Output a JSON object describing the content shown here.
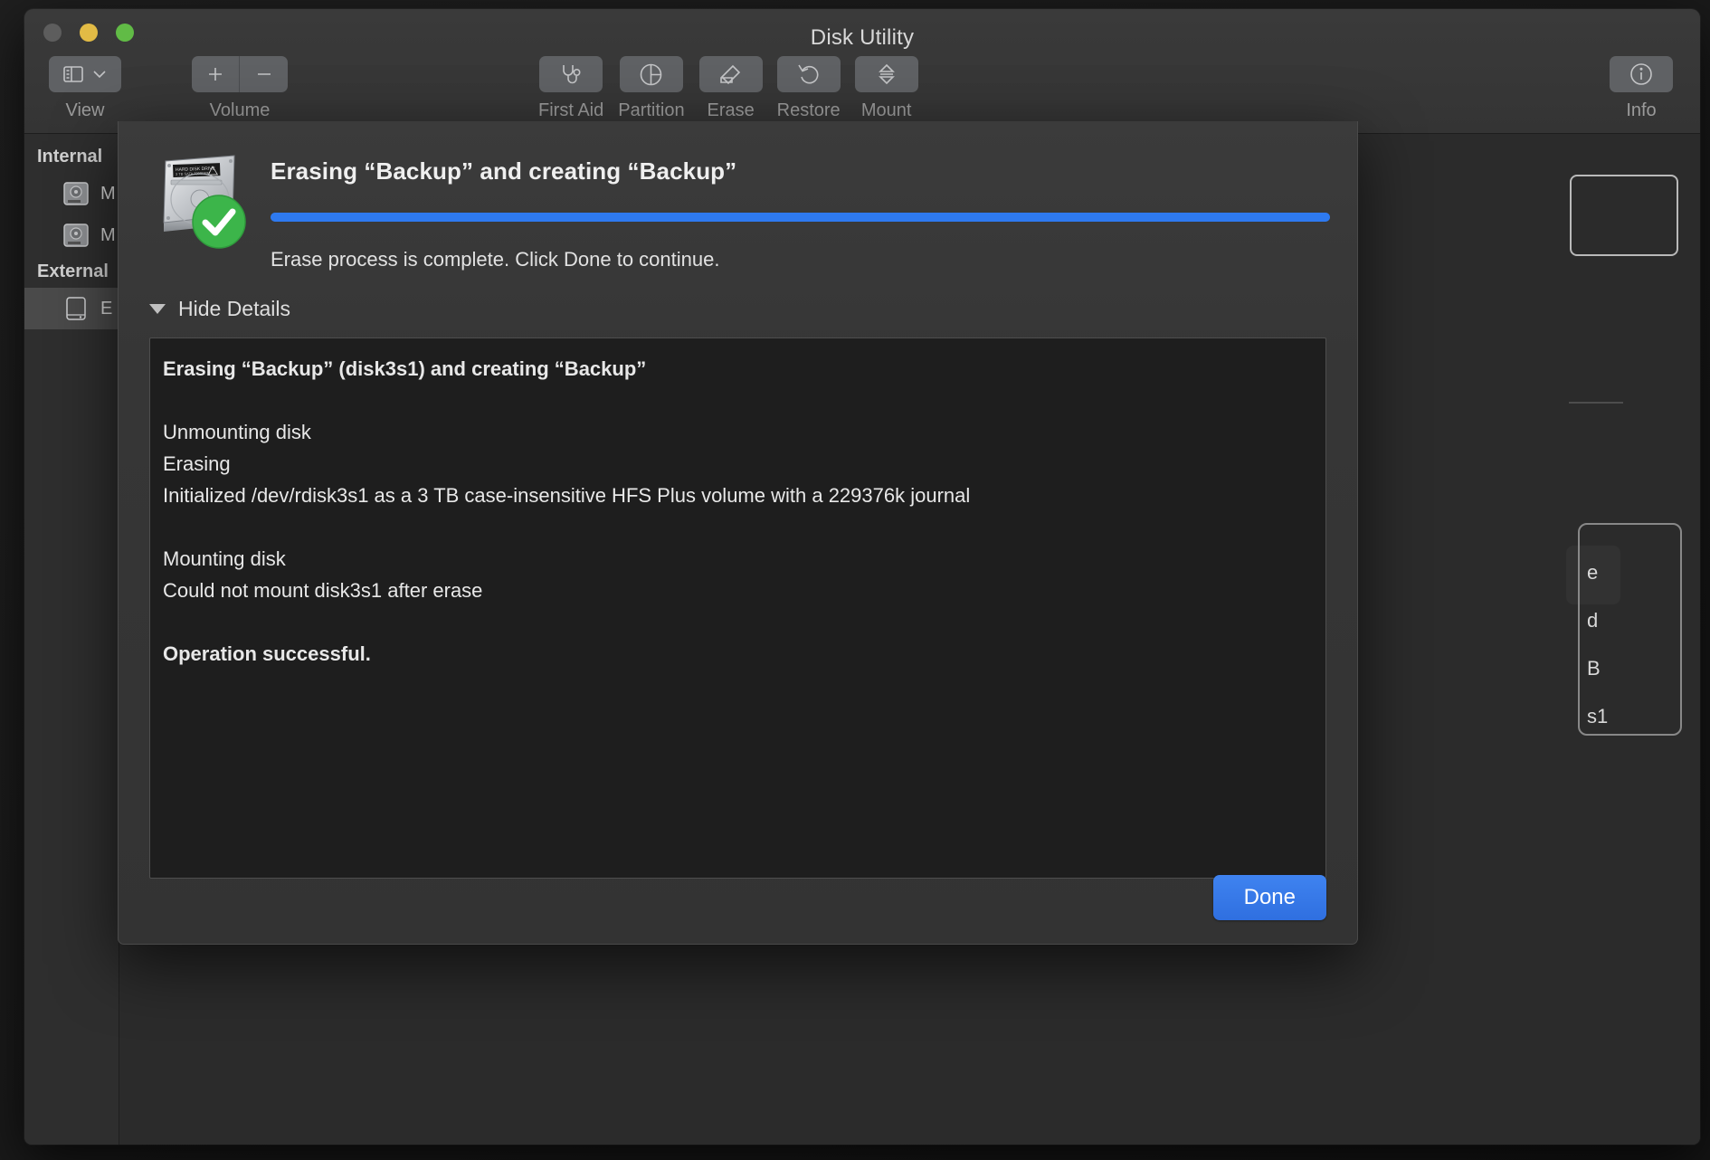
{
  "window": {
    "title": "Disk Utility",
    "traffic_lights": [
      "close-button",
      "minimize-button",
      "zoom-button"
    ]
  },
  "toolbar": {
    "view": {
      "label": "View",
      "icon": "sidebar-icon",
      "chevron": "chevron-down-icon"
    },
    "volume": {
      "label": "Volume",
      "add_icon": "plus-icon",
      "remove_icon": "minus-icon"
    },
    "items": [
      {
        "label": "First Aid",
        "icon": "stethoscope-icon"
      },
      {
        "label": "Partition",
        "icon": "pie-chart-icon"
      },
      {
        "label": "Erase",
        "icon": "erase-icon"
      },
      {
        "label": "Restore",
        "icon": "undo-arrow-icon"
      },
      {
        "label": "Mount",
        "icon": "mount-eject-icon"
      }
    ],
    "info": {
      "label": "Info",
      "icon": "info-circle-icon"
    }
  },
  "sidebar": {
    "sections": [
      {
        "header": "Internal",
        "items": [
          {
            "label": "M",
            "icon": "internal-disk-icon",
            "selected": false
          },
          {
            "label": "M",
            "icon": "internal-disk-icon",
            "selected": false
          }
        ]
      },
      {
        "header": "External",
        "items": [
          {
            "label": "E",
            "icon": "external-disk-icon",
            "selected": true
          }
        ]
      }
    ]
  },
  "background_pane": {
    "partial_labels": [
      "e",
      "d",
      "B",
      "s1"
    ]
  },
  "sheet": {
    "icon": "hard-disk-icon-with-success-badge",
    "title": "Erasing “Backup” and creating “Backup”",
    "progress_percent": 100,
    "subtitle": "Erase process is complete. Click Done to continue.",
    "details_toggle": {
      "label": "Hide Details",
      "icon": "triangle-down-icon",
      "expanded": true
    },
    "log_lines": [
      {
        "text": "Erasing “Backup” (disk3s1) and creating “Backup”",
        "bold": true
      },
      {
        "text": "",
        "bold": false
      },
      {
        "text": "Unmounting disk",
        "bold": false
      },
      {
        "text": "Erasing",
        "bold": false
      },
      {
        "text": "Initialized /dev/rdisk3s1 as a 3 TB case-insensitive HFS Plus volume with a 229376k journal",
        "bold": false
      },
      {
        "text": "",
        "bold": false
      },
      {
        "text": "Mounting disk",
        "bold": false
      },
      {
        "text": "Could not mount disk3s1 after erase",
        "bold": false
      },
      {
        "text": "",
        "bold": false
      },
      {
        "text": "Operation successful.",
        "bold": true
      }
    ],
    "done_label": "Done"
  },
  "colors": {
    "accent_blue": "#2e7af0",
    "button_blue": "#3f83f0",
    "success_green": "#3cb54a",
    "window_bg": "#2b2b2b",
    "sheet_bg": "#363636",
    "log_bg": "#1e1e1e"
  }
}
